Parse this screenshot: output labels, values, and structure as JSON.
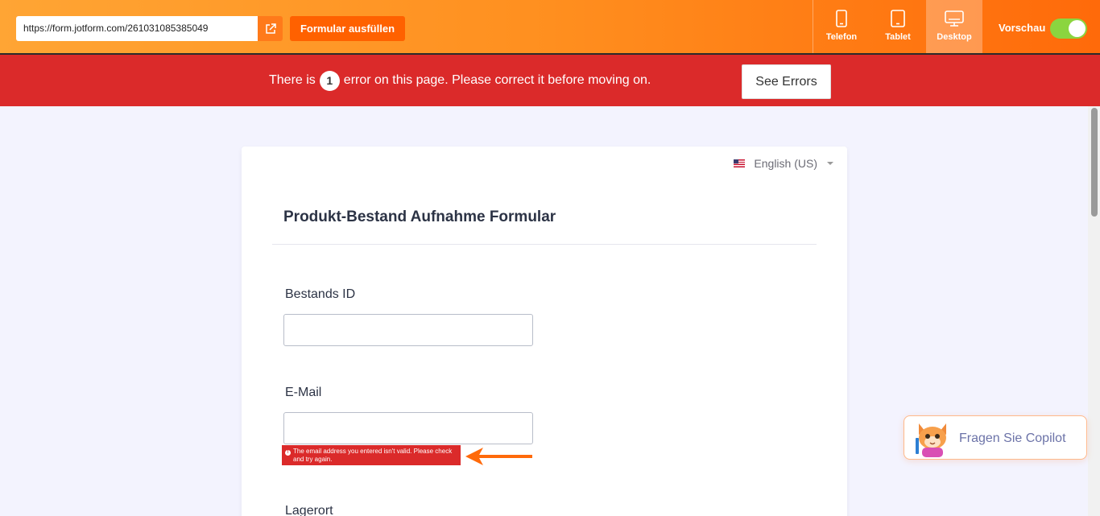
{
  "topbar": {
    "url": "https://form.jotform.com/261031085385049",
    "fill_button": "Formular ausfüllen",
    "devices": [
      {
        "label": "Telefon",
        "icon": "phone-icon",
        "active": false
      },
      {
        "label": "Tablet",
        "icon": "tablet-icon",
        "active": false
      },
      {
        "label": "Desktop",
        "icon": "desktop-icon",
        "active": true
      }
    ],
    "preview_label": "Vorschau",
    "preview_on": true
  },
  "error_banner": {
    "text_before": "There is",
    "count": "1",
    "text_after": "error on this page. Please correct it before moving on.",
    "button": "See Errors"
  },
  "form": {
    "language": "English (US)",
    "title": "Produkt-Bestand Aufnahme Formular",
    "fields": [
      {
        "label": "Bestands ID",
        "value": ""
      },
      {
        "label": "E-Mail",
        "value": "",
        "error": "The email address you entered isn't valid. Please check and try again."
      },
      {
        "label": "Lagerort"
      }
    ]
  },
  "copilot": {
    "label": "Fragen Sie Copilot"
  },
  "colors": {
    "accent": "#ff6100",
    "error": "#db2a2a",
    "toggle_on": "#8bd53f"
  }
}
